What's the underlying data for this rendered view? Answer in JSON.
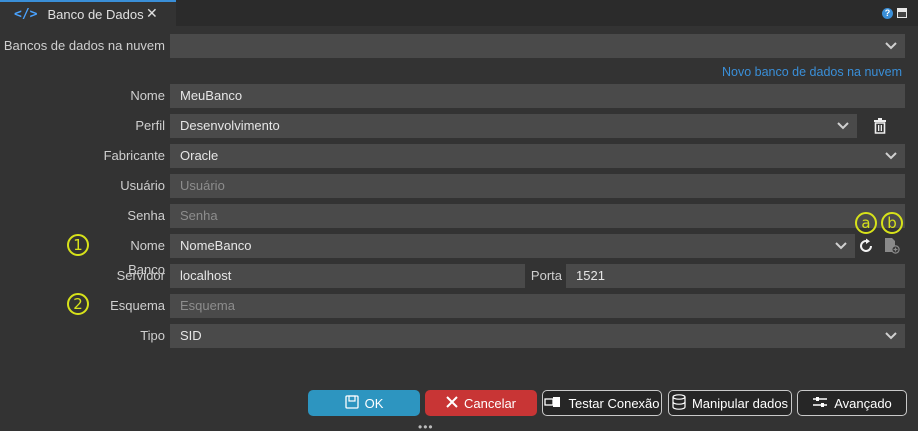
{
  "tab": {
    "title": "Banco de Dados",
    "close": "✕"
  },
  "header": {
    "help": "?"
  },
  "form": {
    "cloud_label": "Bancos de dados na nuvem",
    "cloud_value": "",
    "new_cloud_link": "Novo banco de dados na nuvem",
    "nome_label": "Nome",
    "nome_value": "MeuBanco",
    "perfil_label": "Perfil",
    "perfil_value": "Desenvolvimento",
    "fabricante_label": "Fabricante",
    "fabricante_value": "Oracle",
    "usuario_label": "Usuário",
    "usuario_placeholder": "Usuário",
    "senha_label": "Senha",
    "senha_placeholder": "Senha",
    "nome_banco_label": "Nome Banco",
    "nome_banco_value": "NomeBanco",
    "servidor_label": "Servidor",
    "servidor_value": "localhost",
    "porta_label": "Porta",
    "porta_value": "1521",
    "esquema_label": "Esquema",
    "esquema_placeholder": "Esquema",
    "tipo_label": "Tipo",
    "tipo_value": "SID"
  },
  "badges": {
    "one": "1",
    "two": "2",
    "a": "a",
    "b": "b"
  },
  "buttons": {
    "ok": "OK",
    "cancel": "Cancelar",
    "test": "Testar Conexão",
    "manage": "Manipular dados",
    "advanced": "Avançado"
  },
  "colors": {
    "accent": "#3a8fd8",
    "ok": "#2d95c0",
    "cancel": "#c83535",
    "badge": "#d7e21a"
  }
}
